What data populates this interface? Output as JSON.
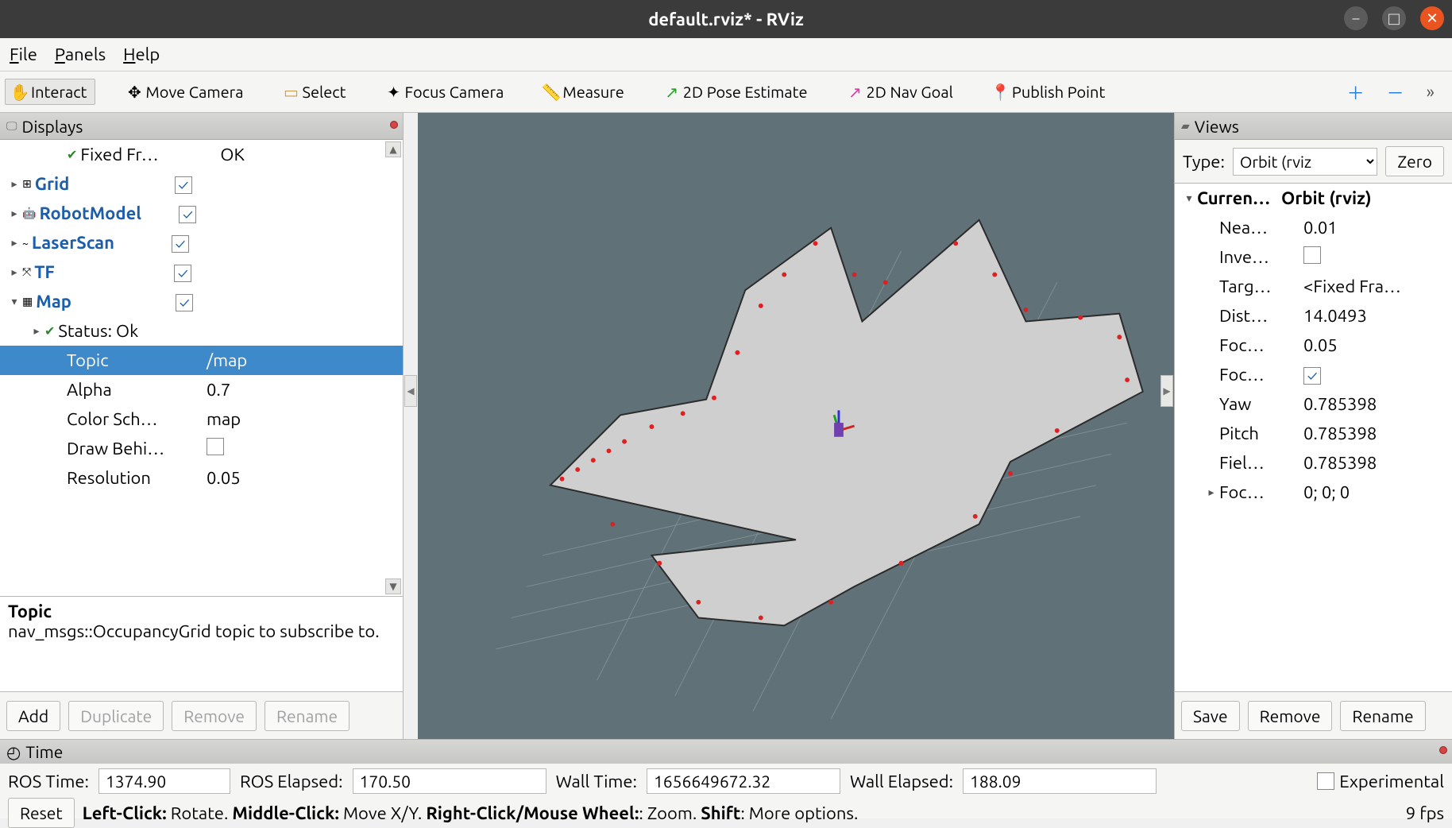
{
  "window": {
    "title": "default.rviz* - RViz"
  },
  "menu": {
    "file": "File",
    "panels": "Panels",
    "help": "Help"
  },
  "toolbar": {
    "interact": "Interact",
    "move_camera": "Move Camera",
    "select": "Select",
    "focus_camera": "Focus Camera",
    "measure": "Measure",
    "pose_estimate": "2D Pose Estimate",
    "nav_goal": "2D Nav Goal",
    "publish_point": "Publish Point"
  },
  "displays": {
    "title": "Displays",
    "rows": [
      {
        "indent": 2,
        "label": "Fixed Fr…",
        "value": "OK",
        "status_ok": true
      },
      {
        "indent": 0,
        "twisty": "▸",
        "label": "Grid",
        "blue": true,
        "check": true,
        "icon": "grid"
      },
      {
        "indent": 0,
        "twisty": "▸",
        "label": "RobotModel",
        "blue": true,
        "check": true,
        "icon": "robot"
      },
      {
        "indent": 0,
        "twisty": "▸",
        "label": "LaserScan",
        "blue": true,
        "check": true,
        "icon": "laser"
      },
      {
        "indent": 0,
        "twisty": "▸",
        "label": "TF",
        "blue": true,
        "check": true,
        "icon": "tf"
      },
      {
        "indent": 0,
        "twisty": "▾",
        "label": "Map",
        "blue": true,
        "check": true,
        "icon": "map"
      },
      {
        "indent": 1,
        "twisty": "▸",
        "label": "Status: Ok",
        "status_ok": true
      },
      {
        "indent": 2,
        "label": "Topic",
        "value": "/map",
        "selected": true
      },
      {
        "indent": 2,
        "label": "Alpha",
        "value": "0.7"
      },
      {
        "indent": 2,
        "label": "Color Sch…",
        "value": "map"
      },
      {
        "indent": 2,
        "label": "Draw Behi…",
        "check": false,
        "check_empty": true
      },
      {
        "indent": 2,
        "label": "Resolution",
        "value": "0.05"
      }
    ],
    "desc": {
      "title": "Topic",
      "text": "nav_msgs::OccupancyGrid topic to subscribe to."
    },
    "buttons": {
      "add": "Add",
      "duplicate": "Duplicate",
      "remove": "Remove",
      "rename": "Rename"
    }
  },
  "views": {
    "title": "Views",
    "type_label": "Type:",
    "type_value": "Orbit (rviz",
    "zero": "Zero",
    "rows": [
      {
        "indent": 0,
        "twisty": "▾",
        "label": "Curren…",
        "bold": true,
        "value": "Orbit (rviz)",
        "value_bold": true
      },
      {
        "indent": 1,
        "label": "Nea…",
        "value": "0.01"
      },
      {
        "indent": 1,
        "label": "Inve…",
        "check_empty": true
      },
      {
        "indent": 1,
        "label": "Targ…",
        "value": "<Fixed Fra…"
      },
      {
        "indent": 1,
        "label": "Dist…",
        "value": "14.0493"
      },
      {
        "indent": 1,
        "label": "Foc…",
        "value": "0.05"
      },
      {
        "indent": 1,
        "label": "Foc…",
        "check": true
      },
      {
        "indent": 1,
        "label": "Yaw",
        "value": "0.785398"
      },
      {
        "indent": 1,
        "label": "Pitch",
        "value": "0.785398"
      },
      {
        "indent": 1,
        "label": "Fiel…",
        "value": "0.785398"
      },
      {
        "indent": 1,
        "twisty": "▸",
        "label": "Foc…",
        "value": "0; 0; 0"
      }
    ],
    "buttons": {
      "save": "Save",
      "remove": "Remove",
      "rename": "Rename"
    }
  },
  "time": {
    "title": "Time",
    "ros_time_label": "ROS Time:",
    "ros_time": "1374.90",
    "ros_elapsed_label": "ROS Elapsed:",
    "ros_elapsed": "170.50",
    "wall_time_label": "Wall Time:",
    "wall_time": "1656649672.32",
    "wall_elapsed_label": "Wall Elapsed:",
    "wall_elapsed": "188.09",
    "experimental": "Experimental",
    "reset": "Reset",
    "hint_html": "Left-Click: Rotate. Middle-Click: Move X/Y. Right-Click/Mouse Wheel:: Zoom. Shift: More options.",
    "fps": "9 fps"
  }
}
